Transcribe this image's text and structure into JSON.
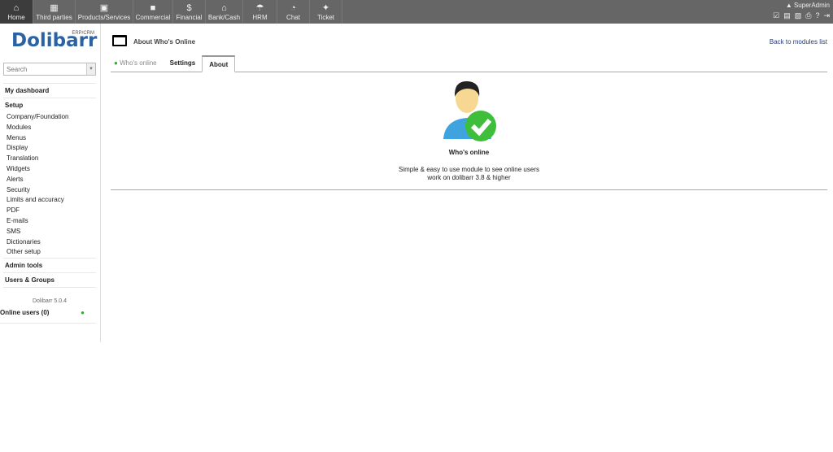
{
  "topmenu": [
    {
      "label": "Home",
      "icon": "home-icon",
      "glyph": "⌂",
      "active": true
    },
    {
      "label": "Third parties",
      "icon": "building-icon",
      "glyph": "▦"
    },
    {
      "label": "Products/Services",
      "icon": "product-icon",
      "glyph": "▣"
    },
    {
      "label": "Commercial",
      "icon": "briefcase-icon",
      "glyph": "■"
    },
    {
      "label": "Financial",
      "icon": "dollar-icon",
      "glyph": "$"
    },
    {
      "label": "Bank/Cash",
      "icon": "bank-icon",
      "glyph": "⌂"
    },
    {
      "label": "HRM",
      "icon": "umbrella-icon",
      "glyph": "☂"
    },
    {
      "label": "Chat",
      "icon": "chat-icon",
      "glyph": "◔"
    },
    {
      "label": "Ticket",
      "icon": "ticket-icon",
      "glyph": "✦"
    }
  ],
  "user": {
    "name": "SuperAdmin"
  },
  "logo": {
    "text": "Dolibarr",
    "sub": "ERP/CRM"
  },
  "search": {
    "placeholder": "Search"
  },
  "sidebar": {
    "dashboard": "My dashboard",
    "setup": "Setup",
    "setup_items": [
      "Company/Foundation",
      "Modules",
      "Menus",
      "Display",
      "Translation",
      "Widgets",
      "Alerts",
      "Security",
      "Limits and accuracy",
      "PDF",
      "E-mails",
      "SMS",
      "Dictionaries",
      "Other setup"
    ],
    "admin_tools": "Admin tools",
    "users_groups": "Users & Groups",
    "version": "Dolibarr 5.0.4",
    "online_users": "Online users (0)"
  },
  "page": {
    "title": "About Who's Online",
    "back": "Back to modules list",
    "tabs": [
      "Who's online",
      "Settings",
      "About"
    ],
    "module_name": "Who's online",
    "desc_line1": "Simple & easy to use module to see online users",
    "desc_line2": "work on dolibarr 3.8 & higher"
  }
}
